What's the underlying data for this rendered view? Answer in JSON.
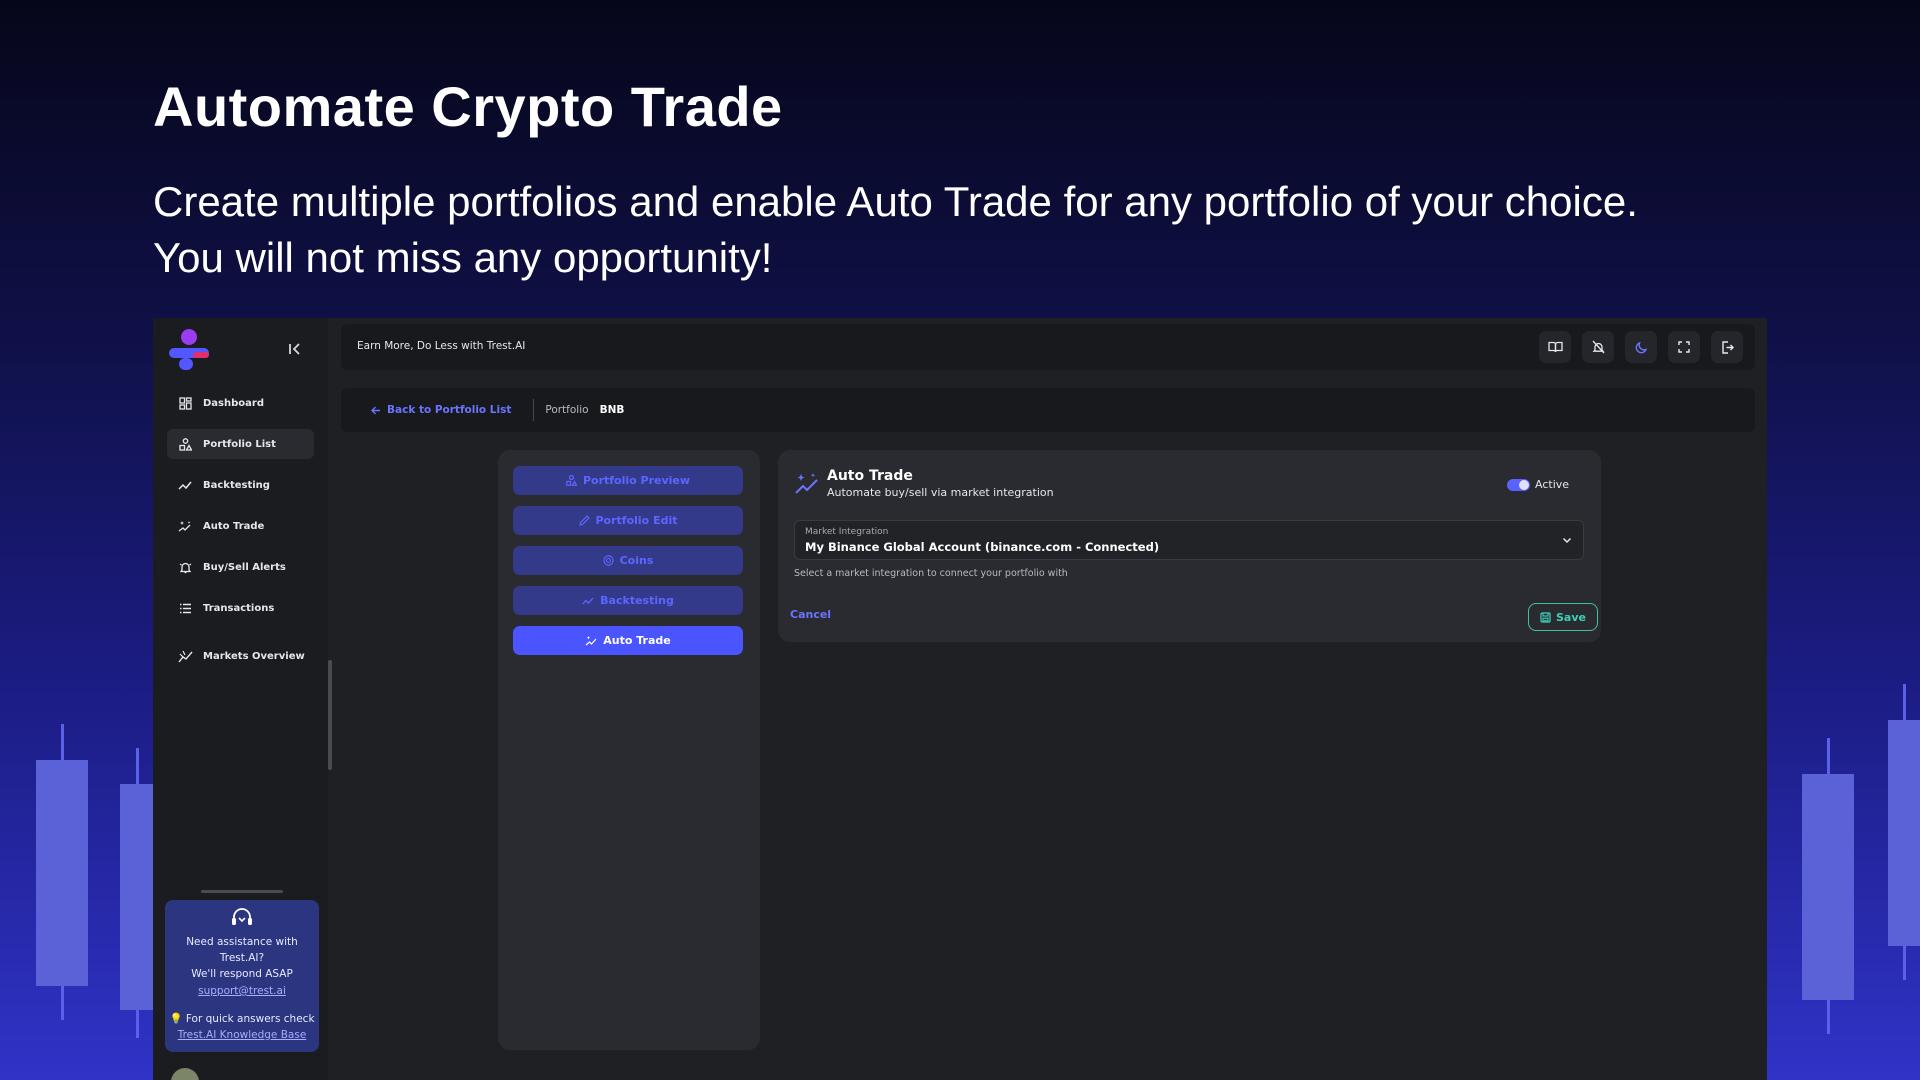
{
  "hero": {
    "title": "Automate Crypto Trade",
    "subtitle_line1": "Create multiple portfolios and enable Auto Trade for any portfolio of your choice.",
    "subtitle_line2": "You will not miss any opportunity!"
  },
  "sidebar": {
    "items": [
      {
        "label": "Dashboard",
        "icon": "dashboard-icon"
      },
      {
        "label": "Portfolio List",
        "icon": "portfolio-icon"
      },
      {
        "label": "Backtesting",
        "icon": "chart-line-icon"
      },
      {
        "label": "Auto Trade",
        "icon": "sparkles-icon"
      },
      {
        "label": "Buy/Sell Alerts",
        "icon": "bell-icon"
      },
      {
        "label": "Transactions",
        "icon": "list-icon"
      },
      {
        "label": "Markets Overview",
        "icon": "market-chart-icon"
      }
    ],
    "active_item": "Portfolio List",
    "help": {
      "line1": "Need assistance with",
      "line2": "Trest.AI?",
      "line3": "We'll respond ASAP",
      "email": "support@trest.ai",
      "quick": "For quick answers check",
      "kb": "Trest.AI Knowledge Base"
    }
  },
  "topbar": {
    "tagline": "Earn More, Do Less with Trest.AI",
    "icons": [
      "book-icon",
      "bell-off-icon",
      "moon-icon",
      "fullscreen-icon",
      "logout-icon"
    ]
  },
  "breadcrumb": {
    "back": "Back to Portfolio List",
    "label": "Portfolio",
    "value": "BNB"
  },
  "tabs": [
    {
      "label": "Portfolio Preview",
      "icon": "shapes-icon"
    },
    {
      "label": "Portfolio Edit",
      "icon": "pencil-icon"
    },
    {
      "label": "Coins",
      "icon": "coin-icon"
    },
    {
      "label": "Backtesting",
      "icon": "chart-line-icon"
    },
    {
      "label": "Auto Trade",
      "icon": "sparkles-icon"
    }
  ],
  "active_tab": "Auto Trade",
  "auto_trade": {
    "title": "Auto Trade",
    "subtitle": "Automate buy/sell via market integration",
    "toggle_label": "Active",
    "toggle_on": true,
    "select_label": "Market Integration",
    "select_value": "My Binance Global Account (binance.com - Connected)",
    "helper": "Select a market integration to connect your portfolio with",
    "cancel": "Cancel",
    "save": "Save"
  },
  "colors": {
    "accent": "#4a55ff",
    "link": "#6b74ff",
    "save": "#3fcfb5",
    "panel": "#2a2b30"
  }
}
